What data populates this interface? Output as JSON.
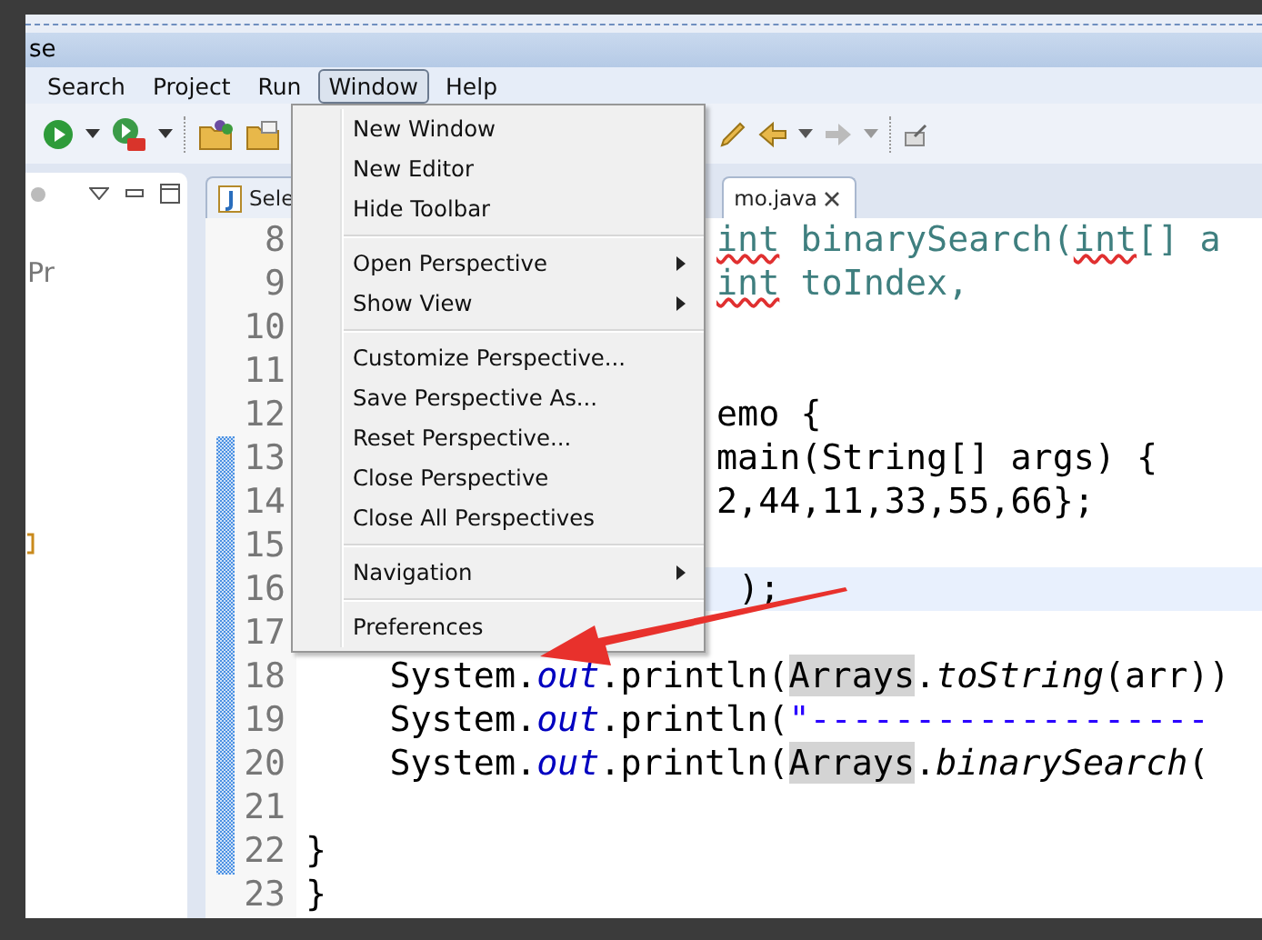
{
  "title_bar": {
    "title": "se"
  },
  "menu_bar": [
    {
      "label": "Search",
      "selected": false
    },
    {
      "label": "Project",
      "selected": false
    },
    {
      "label": "Run",
      "selected": false
    },
    {
      "label": "Window",
      "selected": true
    },
    {
      "label": "Help",
      "selected": false
    }
  ],
  "window_menu": {
    "groups": [
      [
        {
          "label": "New Window",
          "submenu": false
        },
        {
          "label": "New Editor",
          "submenu": false
        },
        {
          "label": "Hide Toolbar",
          "submenu": false
        }
      ],
      [
        {
          "label": "Open Perspective",
          "submenu": true
        },
        {
          "label": "Show View",
          "submenu": true
        }
      ],
      [
        {
          "label": "Customize Perspective...",
          "submenu": false
        },
        {
          "label": "Save Perspective As...",
          "submenu": false
        },
        {
          "label": "Reset Perspective...",
          "submenu": false
        },
        {
          "label": "Close Perspective",
          "submenu": false
        },
        {
          "label": "Close All Perspectives",
          "submenu": false
        }
      ],
      [
        {
          "label": "Navigation",
          "submenu": true
        }
      ],
      [
        {
          "label": "Preferences",
          "submenu": false
        }
      ]
    ]
  },
  "left_panel": {
    "label": "Pr"
  },
  "editor": {
    "tabs": [
      {
        "label": "Sele",
        "selected": false
      },
      {
        "label": "mo.java",
        "selected": true
      }
    ],
    "lines": [
      {
        "number": "8",
        "current": false,
        "kind": "partial",
        "tokens": [
          {
            "kind": "comment-typo",
            "text": "int"
          },
          {
            "kind": "comment",
            "text": " binarySearch("
          },
          {
            "kind": "comment-typo",
            "text": "int"
          },
          {
            "kind": "comment",
            "text": "[] a"
          }
        ]
      },
      {
        "number": "9",
        "current": false,
        "kind": "partial",
        "tokens": [
          {
            "kind": "comment-typo",
            "text": "int"
          },
          {
            "kind": "comment",
            "text": " toIndex,"
          }
        ]
      },
      {
        "number": "10",
        "current": false
      },
      {
        "number": "11",
        "current": false
      },
      {
        "number": "12",
        "current": false,
        "kind": "partial",
        "tokens": [
          {
            "kind": "plain",
            "text": "emo {"
          }
        ]
      },
      {
        "number": "13",
        "current": false,
        "kind": "partial",
        "tokens": [
          {
            "kind": "plain",
            "text": "main(String[] args) {"
          }
        ]
      },
      {
        "number": "14",
        "current": false,
        "kind": "partial",
        "tokens": [
          {
            "kind": "plain",
            "text": "2,44,11,33,55,66};"
          }
        ]
      },
      {
        "number": "15",
        "current": false
      },
      {
        "number": "16",
        "current": true,
        "kind": "partial",
        "tokens": [
          {
            "kind": "plain",
            "text": ");"
          }
        ]
      },
      {
        "number": "17",
        "current": false
      },
      {
        "number": "18",
        "current": false,
        "kind": "full",
        "tokens": [
          {
            "kind": "plain",
            "text": "    System."
          },
          {
            "kind": "field",
            "text": "out"
          },
          {
            "kind": "plain",
            "text": ".println("
          },
          {
            "kind": "marked",
            "text": "Arrays"
          },
          {
            "kind": "plain",
            "text": "."
          },
          {
            "kind": "static-call",
            "text": "toString"
          },
          {
            "kind": "plain",
            "text": "(arr))"
          }
        ]
      },
      {
        "number": "19",
        "current": false,
        "kind": "full",
        "tokens": [
          {
            "kind": "plain",
            "text": "    System."
          },
          {
            "kind": "field",
            "text": "out"
          },
          {
            "kind": "plain",
            "text": ".println("
          },
          {
            "kind": "string",
            "text": "\"-------------------"
          }
        ]
      },
      {
        "number": "20",
        "current": false,
        "kind": "full",
        "tokens": [
          {
            "kind": "plain",
            "text": "    System."
          },
          {
            "kind": "field",
            "text": "out"
          },
          {
            "kind": "plain",
            "text": ".println("
          },
          {
            "kind": "marked",
            "text": "Arrays"
          },
          {
            "kind": "plain",
            "text": "."
          },
          {
            "kind": "static-call",
            "text": "binarySearch"
          },
          {
            "kind": "plain",
            "text": "("
          }
        ]
      },
      {
        "number": "21",
        "current": false
      },
      {
        "number": "22",
        "current": false,
        "kind": "full",
        "tokens": [
          {
            "kind": "plain",
            "text": "}"
          }
        ]
      },
      {
        "number": "23",
        "current": false,
        "kind": "full",
        "tokens": [
          {
            "kind": "plain",
            "text": "}"
          }
        ]
      }
    ]
  }
}
